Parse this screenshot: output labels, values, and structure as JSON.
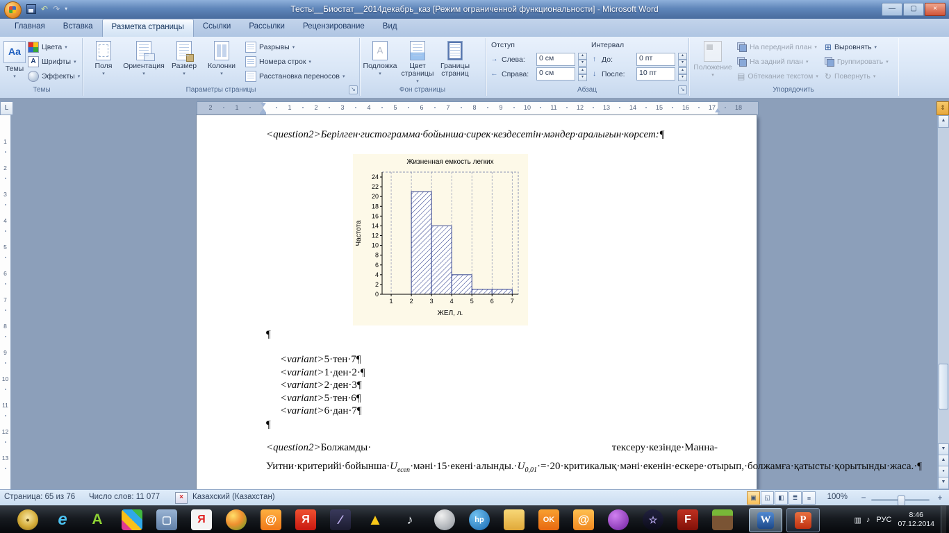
{
  "window": {
    "title": "Тесты__Биостат__2014декабрь_каз [Режим ограниченной функциональности]  -  Microsoft Word"
  },
  "icons": {
    "dropdown": "▾",
    "dialog_launcher": "↘",
    "spin_up": "▴",
    "spin_down": "▾",
    "undo": "↶",
    "redo": "↷",
    "qat_menu": "▾",
    "minimize": "—",
    "restore": "▢",
    "close": "×",
    "themes": "Aa",
    "fonts": "A",
    "indent_left": "→",
    "indent_right": "←",
    "space_before": "↑",
    "space_after": "↓",
    "align": "⊞",
    "rotate": "↻",
    "wrap": "▤",
    "tab_selector": "L",
    "ruler_toggle": "⇕",
    "scroll_up": "▲",
    "scroll_down": "▼",
    "browse_prev": "▲",
    "browse_dot": "●",
    "browse_next": "▼",
    "spell": "×",
    "zoom_minus": "−",
    "zoom_plus": "+",
    "views": [
      "▣",
      "◱",
      "◧",
      "≣",
      "≡"
    ]
  },
  "tabs": [
    {
      "label": "Главная",
      "active": false
    },
    {
      "label": "Вставка",
      "active": false
    },
    {
      "label": "Разметка страницы",
      "active": true
    },
    {
      "label": "Ссылки",
      "active": false
    },
    {
      "label": "Рассылки",
      "active": false
    },
    {
      "label": "Рецензирование",
      "active": false
    },
    {
      "label": "Вид",
      "active": false
    }
  ],
  "ribbon": {
    "groups": {
      "themes": {
        "label": "Темы",
        "big_label": "Темы",
        "items": [
          "Цвета",
          "Шрифты",
          "Эффекты"
        ]
      },
      "page_setup": {
        "label": "Параметры страницы",
        "big": [
          "Поля",
          "Ориентация",
          "Размер",
          "Колонки"
        ],
        "small": [
          "Разрывы",
          "Номера строк",
          "Расстановка переносов"
        ]
      },
      "page_bg": {
        "label": "Фон страницы",
        "big": [
          "Подложка",
          "Цвет страницы",
          "Границы страниц"
        ]
      },
      "paragraph": {
        "label": "Абзац",
        "indent_title": "Отступ",
        "spacing_title": "Интервал",
        "rows": [
          {
            "label": "Слева:",
            "value": "0 см"
          },
          {
            "label": "Справа:",
            "value": "0 см"
          },
          {
            "label": "До:",
            "value": "0 пт"
          },
          {
            "label": "После:",
            "value": "10 пт"
          }
        ]
      },
      "arrange": {
        "label": "Упорядочить",
        "big_label": "Положение",
        "col1": [
          "На передний план",
          "На задний план",
          "Обтекание текстом"
        ],
        "col2": [
          "Выровнять",
          "Группировать",
          "Повернуть"
        ]
      }
    }
  },
  "ruler": {
    "h_numbers_margin_left": [
      "2",
      "1"
    ],
    "h_numbers_text": [
      "1",
      "2",
      "3",
      "4",
      "5",
      "6",
      "7",
      "8",
      "9",
      "10",
      "11",
      "12",
      "13",
      "14",
      "15",
      "16",
      "17"
    ],
    "h_numbers_margin_right": [
      "18"
    ],
    "v_numbers": [
      "1",
      "2",
      "3",
      "4",
      "5",
      "6",
      "7",
      "8",
      "9",
      "10",
      "11",
      "12",
      "13"
    ]
  },
  "document": {
    "pilcrow": "¶",
    "q1_tag": "<question2>",
    "q1_text": "Берілген·гистограмма·бойынша·сирек·кездесетін·мәндер·аралығын·көрсет:",
    "variants": [
      {
        "tag": "<variant>",
        "text": "5·тен·7"
      },
      {
        "tag": "<variant>",
        "text": "1·ден·2·"
      },
      {
        "tag": "<variant>",
        "text": "2·ден·3"
      },
      {
        "tag": "<variant>",
        "text": "5·тен·6"
      },
      {
        "tag": "<variant>",
        "text": "6·дан·7"
      }
    ],
    "q2_tag": "<question2>",
    "q2_part1": "Болжамды· тексеру·кезінде·Манна-Уитни·критерийі·бойынша·",
    "q2_u1": "U",
    "q2_u1_sub": "есеп",
    "q2_part2": "·мәні·15·екені·алынды.·",
    "q2_u2": "U",
    "q2_u2_sub": "0,01",
    "q2_part3": "·=·20·критикалық·мәні·екенін·ескере·отырып,·болжамға·қатысты·қорытынды·жаса.·"
  },
  "chart_data": {
    "type": "bar",
    "title": "Жизненная емкость легких",
    "xlabel": "ЖЕЛ, л.",
    "ylabel": "Частота",
    "bin_edges": [
      2,
      3,
      4,
      5,
      6,
      7
    ],
    "values": [
      21,
      14,
      4,
      1,
      1
    ],
    "xticks": [
      1,
      2,
      3,
      4,
      5,
      6,
      7
    ],
    "yticks": [
      0,
      2,
      4,
      6,
      8,
      10,
      12,
      14,
      16,
      18,
      20,
      22,
      24
    ],
    "xlim": [
      0.55,
      7.3
    ],
    "ylim": [
      0,
      25
    ],
    "bar_fill": "diagonal-hatch",
    "bar_color": "#31418f",
    "plot_bg": "#fdf9e8",
    "grid": "dashed-vertical"
  },
  "status_bar": {
    "page": "Страница: 65 из 76",
    "words": "Число слов: 11 077",
    "language": "Казахский (Казахстан)",
    "zoom": "100%"
  },
  "taskbar": {
    "icons": [
      {
        "name": "start-disc-icon",
        "glyph": "•",
        "bg": "radial-gradient(circle at 50% 40%,#f8e8a8,#d4ac38 55%,#8a6a1c)",
        "fg": "#5a4510",
        "fs": 14,
        "round": true
      },
      {
        "name": "internet-explorer-icon",
        "glyph": "e",
        "bg": "transparent",
        "fg": "#4cc2f1",
        "fs": 24
      },
      {
        "name": "aimp-icon",
        "glyph": "A",
        "bg": "transparent",
        "fg": "#8ed234",
        "fs": 21
      },
      {
        "name": "media-mosaic-icon",
        "glyph": "",
        "bg": "linear-gradient(45deg,#e03a90 25%,#f8c018 25% 50%,#30a8e8 50% 75%,#40b840 75%)",
        "fg": "#fff",
        "fs": 12
      },
      {
        "name": "app-window-icon",
        "glyph": "▢",
        "bg": "linear-gradient(#9ab4d4,#5f7ea6)",
        "fg": "#f0f6fc",
        "fs": 15
      },
      {
        "name": "yandex-white-icon",
        "glyph": "Я",
        "bg": "#f4f4f4",
        "fg": "#e02222",
        "fs": 16
      },
      {
        "name": "color-sphere-icon",
        "glyph": "",
        "bg": "radial-gradient(circle at 35% 30%,#ffe06a,#f09030 45%,#58a024)",
        "fg": "#fff",
        "fs": 12,
        "round": true
      },
      {
        "name": "mail-agent-icon",
        "glyph": "@",
        "bg": "linear-gradient(#ffb040,#f07818)",
        "fg": "#fff",
        "fs": 17
      },
      {
        "name": "yandex-red-icon",
        "glyph": "Я",
        "bg": "linear-gradient(#f05030,#c81810)",
        "fg": "#fff",
        "fs": 16
      },
      {
        "name": "pen-app-icon",
        "glyph": "∕",
        "bg": "linear-gradient(#3a3a5c,#1c1c30)",
        "fg": "#c0b0f0",
        "fs": 18
      },
      {
        "name": "warning-app-icon",
        "glyph": "▲",
        "bg": "transparent",
        "fg": "#f8c818",
        "fs": 22
      },
      {
        "name": "volume-app-icon",
        "glyph": "♪",
        "bg": "transparent",
        "fg": "#e8edf2",
        "fs": 18
      },
      {
        "name": "gray-sphere-icon",
        "glyph": "",
        "bg": "radial-gradient(circle at 35% 30%,#f0f0f0,#8a9098)",
        "fg": "#fff",
        "fs": 12,
        "round": true
      },
      {
        "name": "hp-icon",
        "glyph": "hp",
        "bg": "radial-gradient(circle at 35% 30%,#70c0f0,#1668b0)",
        "fg": "#fff",
        "fs": 11,
        "round": true
      },
      {
        "name": "folder-icon",
        "glyph": "",
        "bg": "linear-gradient(#f8d878,#e0a838)",
        "fg": "#fff",
        "fs": 12
      },
      {
        "name": "odnoklassniki-icon",
        "glyph": "OK",
        "bg": "linear-gradient(#f8a030,#e86810)",
        "fg": "#fff",
        "fs": 11
      },
      {
        "name": "mail-agent2-icon",
        "glyph": "@",
        "bg": "linear-gradient(#ffc050,#f08820)",
        "fg": "#fff",
        "fs": 17
      },
      {
        "name": "purple-sphere-icon",
        "glyph": "",
        "bg": "radial-gradient(circle at 35% 30%,#d080f0,#7020a0)",
        "fg": "#fff",
        "fs": 12,
        "round": true
      },
      {
        "name": "galaxy-app-icon",
        "glyph": "☆",
        "bg": "linear-gradient(#222240,#0a0a18)",
        "fg": "#b8a8f0",
        "fs": 14,
        "round": true
      },
      {
        "name": "flash-icon",
        "glyph": "F",
        "bg": "linear-gradient(#c03020,#801008)",
        "fg": "#fff",
        "fs": 16
      },
      {
        "name": "minecraft-icon",
        "glyph": "",
        "bg": "linear-gradient(#78b838 0 30%,#7a5434 30%)",
        "fg": "#fff",
        "fs": 12
      }
    ],
    "windows": [
      {
        "name": "word-window-button",
        "glyph": "W",
        "bg": "linear-gradient(#5088d0,#1c4888)",
        "fg": "#fff",
        "active": true
      },
      {
        "name": "powerpoint-window-button",
        "glyph": "P",
        "bg": "linear-gradient(#e87040,#c03010)",
        "fg": "#fff",
        "active": false
      }
    ]
  },
  "tray": {
    "icons": [
      {
        "name": "tray-display-icon",
        "glyph": "▥"
      },
      {
        "name": "tray-volume-icon",
        "glyph": "♪"
      }
    ],
    "lang": "РУС",
    "time": "8:46",
    "date": "07.12.2014"
  }
}
